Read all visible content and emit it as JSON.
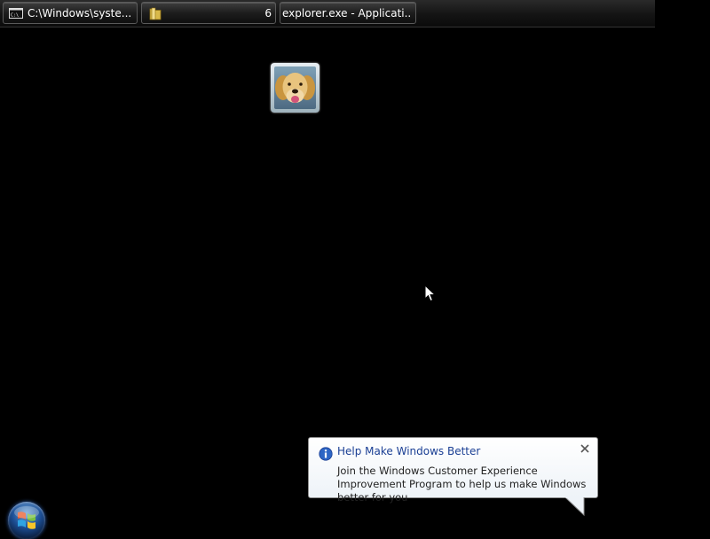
{
  "taskbar": {
    "buttons": [
      {
        "label": "C:\\Windows\\syste...",
        "icon": "console-icon"
      },
      {
        "label": "",
        "count": "6",
        "icon": "folder-icon"
      },
      {
        "label": "explorer.exe - Applicati..."
      }
    ]
  },
  "desktop": {
    "user_tile_icon": "dog-user-picture"
  },
  "balloon": {
    "title": "Help Make Windows Better",
    "body": "Join the Windows Customer Experience Improvement Program to help us make Windows better for you",
    "icon": "info-icon",
    "close_icon": "close-icon"
  },
  "start": {
    "icon": "windows-start-orb"
  },
  "colors": {
    "desktop_background": "#000000",
    "balloon_title": "#1a3f94"
  }
}
